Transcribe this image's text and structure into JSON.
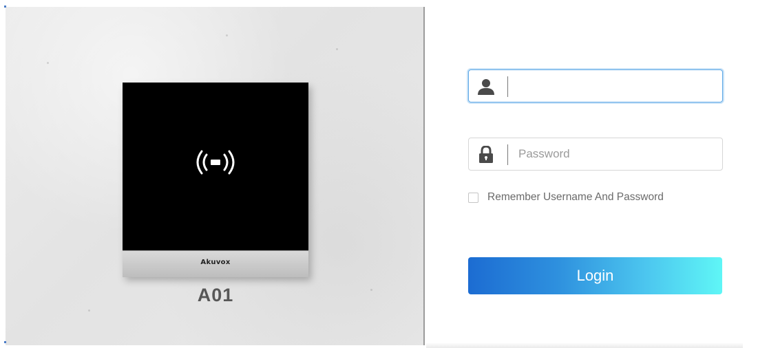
{
  "product": {
    "brand": "Akuvox",
    "model": "A01",
    "device_icon": "nfc-card-icon"
  },
  "login_form": {
    "username": {
      "icon": "user-icon",
      "value": "",
      "placeholder": ""
    },
    "password": {
      "icon": "lock-icon",
      "value": "",
      "placeholder": "Password"
    },
    "remember": {
      "label": "Remember Username And Password",
      "checked": false
    },
    "login_label": "Login"
  },
  "colors": {
    "button_gradient_start": "#1c6cd2",
    "button_gradient_end": "#5ff6f6",
    "focus_border": "#5aa6e6",
    "icon_color": "#4a4a4a"
  }
}
